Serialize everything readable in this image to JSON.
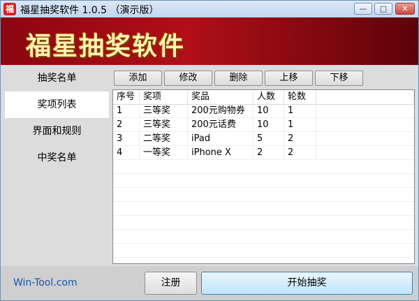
{
  "window": {
    "title": "福星抽奖软件 1.0.5 （演示版）",
    "icon_glyph": "福",
    "controls": {
      "minimize": "—",
      "maximize": "□",
      "close": "✕"
    }
  },
  "banner": {
    "title": "福星抽奖软件"
  },
  "sidebar": {
    "items": [
      {
        "label": "抽奖名单",
        "active": false
      },
      {
        "label": "奖项列表",
        "active": true
      },
      {
        "label": "界面和规则",
        "active": false
      },
      {
        "label": "中奖名单",
        "active": false
      }
    ]
  },
  "toolbar": {
    "add": "添加",
    "edit": "修改",
    "delete": "删除",
    "move_up": "上移",
    "move_down": "下移"
  },
  "table": {
    "columns": [
      "序号",
      "奖项",
      "奖品",
      "人数",
      "轮数"
    ],
    "rows": [
      [
        "1",
        "三等奖",
        "200元购物券",
        "10",
        "1"
      ],
      [
        "2",
        "三等奖",
        "200元话费",
        "10",
        "1"
      ],
      [
        "3",
        "二等奖",
        "iPad",
        "5",
        "2"
      ],
      [
        "4",
        "一等奖",
        "iPhone X",
        "2",
        "2"
      ]
    ]
  },
  "footer": {
    "brand": "Win-Tool.com",
    "register": "注册",
    "start": "开始抽奖"
  },
  "colors": {
    "banner": "#b10f18",
    "banner_text": "#fff2b3",
    "brand_link": "#1b55b5"
  }
}
